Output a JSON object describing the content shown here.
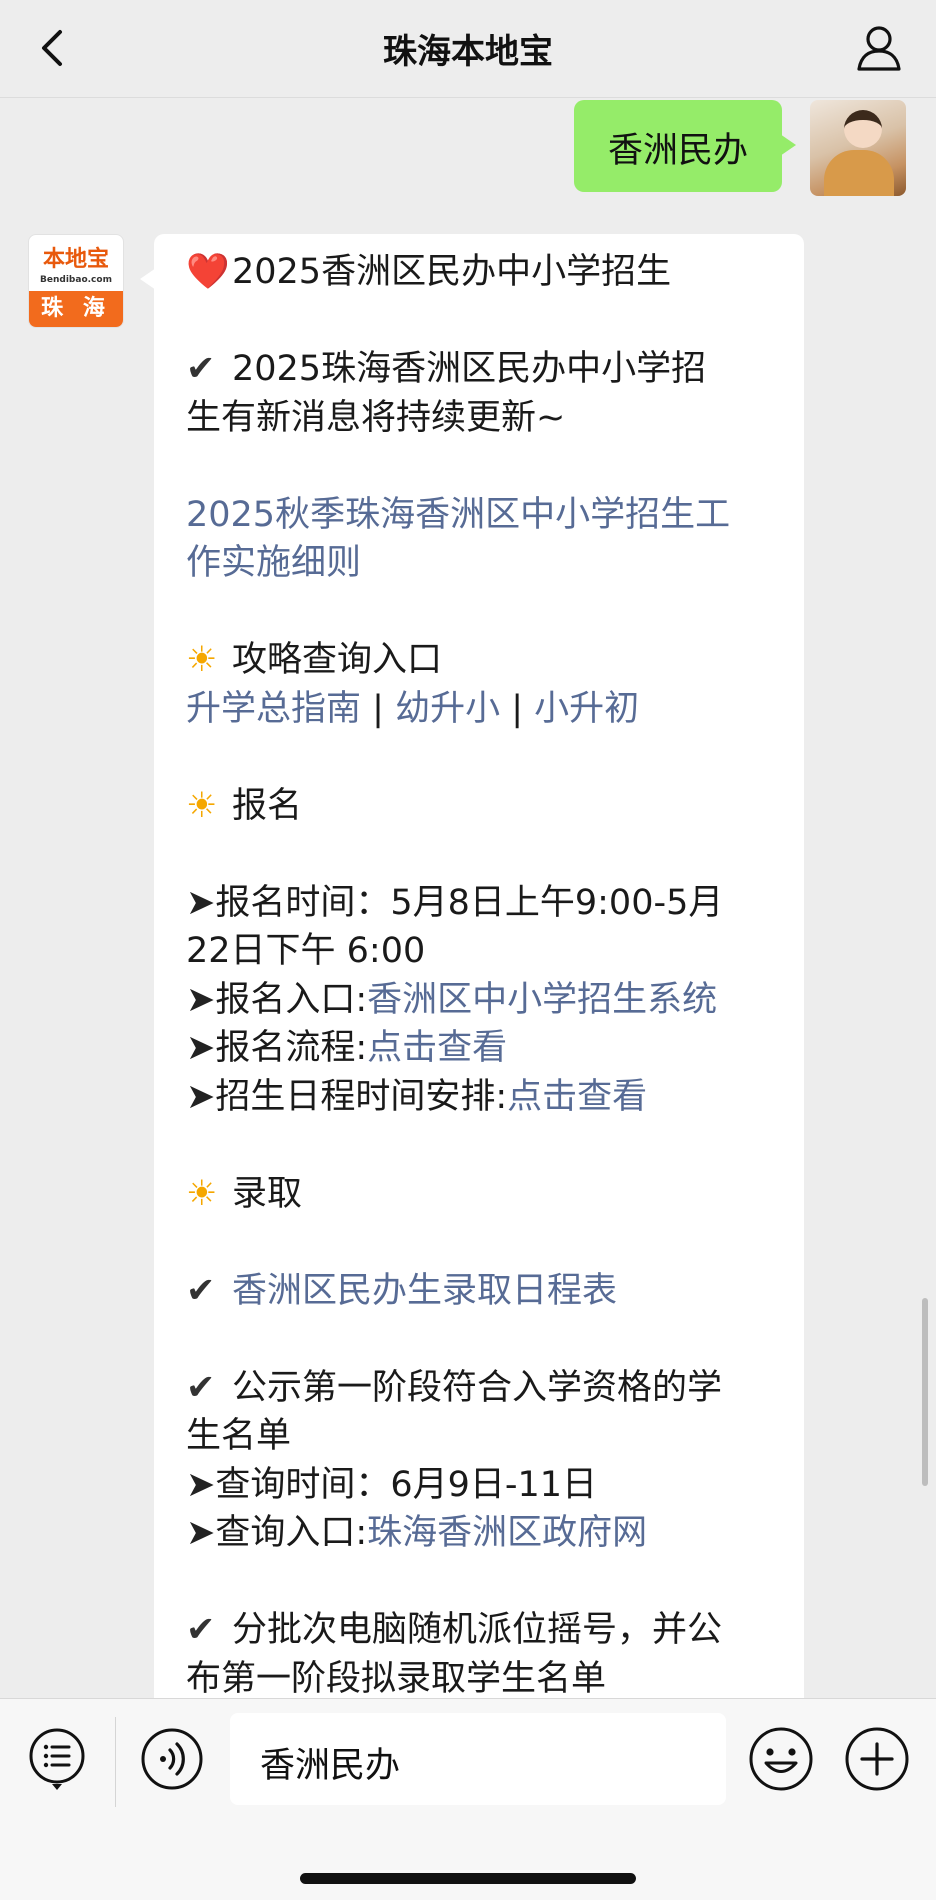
{
  "header": {
    "title": "珠海本地宝"
  },
  "outgoing_message": {
    "text": "香洲民办"
  },
  "bot_avatar": {
    "logo_text": "本地宝",
    "logo_url": "Bendibao.com",
    "city": "珠 海"
  },
  "reply": {
    "lines": [
      {
        "emoji": "❤️",
        "text": "2025香洲区民办中小学招生"
      },
      {
        "text": ""
      },
      {
        "emoji": "✔",
        "text": "2025珠海香洲区民办中小学招"
      },
      {
        "text": "生有新消息将持续更新~"
      },
      {
        "text": ""
      },
      {
        "link": "2025秋季珠海香洲区中小学招生工"
      },
      {
        "link": "作实施细则"
      },
      {
        "text": ""
      },
      {
        "emoji": "☀",
        "text": "攻略查询入口"
      },
      {
        "links": [
          "升学总指南",
          "幼升小",
          "小升初"
        ],
        "sep": " | "
      },
      {
        "text": ""
      },
      {
        "emoji": "☀",
        "text": "报名"
      },
      {
        "text": ""
      },
      {
        "arrow": "➤",
        "text": "报名时间：5月8日上午9:00-5月"
      },
      {
        "text": "22日下午 6:00"
      },
      {
        "arrow": "➤",
        "text": "报名入口:",
        "link": "香洲区中小学招生系统"
      },
      {
        "arrow": "➤",
        "text": "报名流程:",
        "link": "点击查看"
      },
      {
        "arrow": "➤",
        "text": "招生日程时间安排:",
        "link": "点击查看"
      },
      {
        "text": ""
      },
      {
        "emoji": "☀",
        "text": "录取"
      },
      {
        "text": ""
      },
      {
        "emoji": "✔",
        "link": "香洲区民办生录取日程表"
      },
      {
        "text": ""
      },
      {
        "emoji": "✔",
        "text": "公示第一阶段符合入学资格的学"
      },
      {
        "text": "生名单"
      },
      {
        "arrow": "➤",
        "text": "查询时间：6月9日-11日"
      },
      {
        "arrow": "➤",
        "text": "查询入口:",
        "link": "珠海香洲区政府网"
      },
      {
        "text": ""
      },
      {
        "emoji": "✔",
        "text": "分批次电脑随机派位摇号，并公"
      },
      {
        "text": "布第一阶段拟录取学生名单"
      }
    ]
  },
  "input_bar": {
    "input_value": "香洲民办"
  },
  "colors": {
    "background": "#ededed",
    "outgoing_bubble": "#95ec69",
    "link": "#576b95",
    "brand_orange": "#f26b1d"
  },
  "icons": [
    "back-arrow-icon",
    "profile-icon",
    "menu-list-icon",
    "voice-icon",
    "emoji-icon",
    "plus-icon"
  ]
}
